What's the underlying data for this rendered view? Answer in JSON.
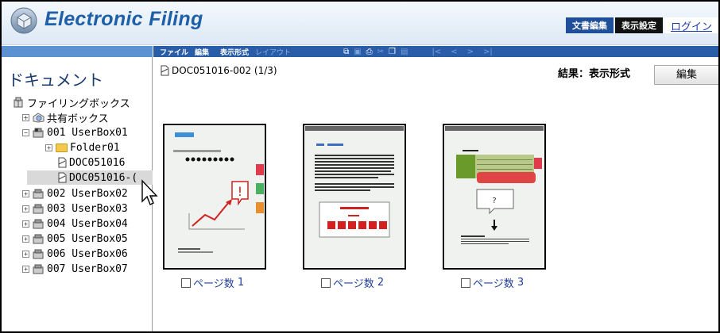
{
  "header": {
    "app_title": "Electronic Filing",
    "tab_edit": "文書編集",
    "tab_view": "表示設定",
    "login_link": "ログイン"
  },
  "sidebar": {
    "title": "ドキュメント",
    "root": "ファイリングボックス",
    "shared": "共有ボックス",
    "boxes": [
      "001 UserBox01",
      "002 UserBox02",
      "003 UserBox03",
      "004 UserBox04",
      "005 UserBox05",
      "006 UserBox06",
      "007 UserBox07"
    ],
    "folder": "Folder01",
    "docs": [
      "DOC051016",
      "DOC051016-("
    ]
  },
  "toolbar": {
    "file": "ファイル",
    "edit": "編集",
    "view_format": "表示形式",
    "layout": "レイアウト"
  },
  "main": {
    "doc_title": "DOC051016-002 (1/3)",
    "result_label": "結果：表示形式",
    "edit_button": "編集",
    "pages": [
      {
        "label": "ページ数",
        "number": "1"
      },
      {
        "label": "ページ数",
        "number": "2"
      },
      {
        "label": "ページ数",
        "number": "3"
      }
    ]
  },
  "colors": {
    "accent_blue": "#1d5fa8",
    "toolbar_blue": "#2a5da8",
    "band_blue": "#5d92d2"
  }
}
